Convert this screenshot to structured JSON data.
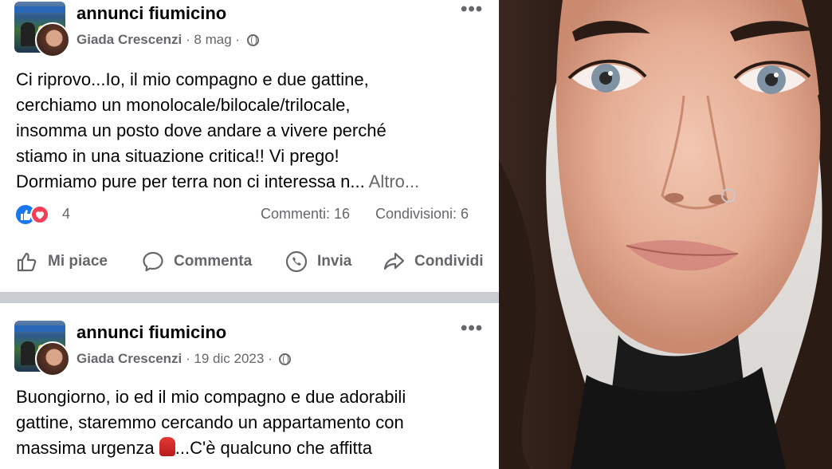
{
  "posts": [
    {
      "group": "annunci fiumicino",
      "author": "Giada Crescenzi",
      "date": "8 mag",
      "sep": "·",
      "lines": [
        "Ci riprovo...Io, il mio compagno e due gattine,",
        "cerchiamo un monolocale/bilocale/trilocale,",
        "insomma un posto dove andare a vivere perché",
        "stiamo in una situazione critica!! Vi prego!",
        "Dormiamo pure per terra non ci interessa n..."
      ],
      "more": "Altro...",
      "reactions_count": "4",
      "comments": "Commenti: 16",
      "shares": "Condivisioni: 6",
      "actions": {
        "like": "Mi piace",
        "comment": "Commenta",
        "send": "Invia",
        "share": "Condividi"
      }
    },
    {
      "group": "annunci fiumicino",
      "author": "Giada Crescenzi",
      "date": "19 dic 2023",
      "sep": "·",
      "lines": [
        "Buongiorno, io ed il mio compagno e due adorabili",
        "gattine, staremmo cercando un appartamento con",
        "massima urgenza",
        "...C'è qualcuno che affitta"
      ]
    }
  ],
  "icons": {
    "more": "more-horizontal-icon",
    "privacy": "globe-icon",
    "like": "thumbs-up-icon",
    "comment": "comment-bubble-icon",
    "send": "messenger-icon",
    "share": "share-arrow-icon"
  },
  "colors": {
    "text": "#050505",
    "secondary": "#65676b",
    "like_blue": "#1877f2",
    "love_red": "#f33e58",
    "divider": "#c9ccd1"
  }
}
